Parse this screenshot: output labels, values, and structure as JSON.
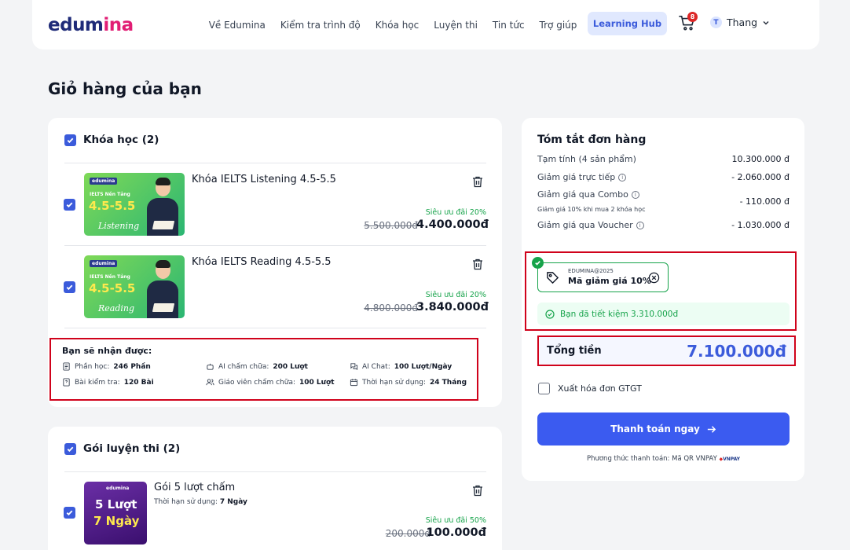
{
  "header": {
    "logo_main": "edum",
    "logo_accent": "ina",
    "nav": [
      "Về Edumina",
      "Kiểm tra trình độ",
      "Khóa học",
      "Luyện thi",
      "Tin tức",
      "Trợ giúp"
    ],
    "hub_label": "Learning Hub",
    "cart_count": "8",
    "user_initial": "T",
    "user_name": "Thang"
  },
  "page_title": "Giỏ hàng của bạn",
  "courses": {
    "section_label": "Khóa học (2)",
    "items": [
      {
        "name": "Khóa IELTS Listening 4.5-5.5",
        "thumb_brand": "edumina",
        "thumb_sub": "IELTS Nền Tảng",
        "thumb_big": "4.5-5.5",
        "thumb_script": "Listening",
        "promo": "Siêu ưu đãi 20%",
        "old_price": "5.500.000đ",
        "new_price": "4.400.000đ"
      },
      {
        "name": "Khóa IELTS Reading 4.5-5.5",
        "thumb_brand": "edumina",
        "thumb_sub": "IELTS Nền Tảng",
        "thumb_big": "4.5-5.5",
        "thumb_script": "Reading",
        "promo": "Siêu ưu đãi 20%",
        "old_price": "4.800.000đ",
        "new_price": "3.840.000đ"
      }
    ],
    "benefits": {
      "title": "Bạn sẽ nhận được:",
      "items": [
        {
          "label": "Phần học:",
          "value": "246 Phần"
        },
        {
          "label": "AI chấm chữa:",
          "value": "200 Lượt"
        },
        {
          "label": "AI Chat:",
          "value": "100 Lượt/Ngày"
        },
        {
          "label": "Bài kiểm tra:",
          "value": "120 Bài"
        },
        {
          "label": "Giáo viên chấm chữa:",
          "value": "100 Lượt"
        },
        {
          "label": "Thời hạn sử dụng:",
          "value": "24 Tháng"
        }
      ]
    }
  },
  "exam_packs": {
    "section_label": "Gói luyện thi (2)",
    "items": [
      {
        "name": "Gói 5 lượt chấm",
        "sub_label": "Thời hạn sử dụng:",
        "sub_value": "7 Ngày",
        "thumb_brand": "edumina",
        "thumb_line1": "5 Lượt",
        "thumb_line2": "7 Ngày",
        "promo": "Siêu ưu đãi 50%",
        "old_price": "200.000đ",
        "new_price": "100.000đ"
      }
    ]
  },
  "summary": {
    "title": "Tóm tắt đơn hàng",
    "rows": [
      {
        "label": "Tạm tính (4 sản phẩm)",
        "value": "10.300.000 đ"
      },
      {
        "label": "Giảm giá trực tiếp",
        "value": "- 2.060.000 đ"
      },
      {
        "label": "Giảm giá qua Combo",
        "value": "- 110.000 đ"
      },
      {
        "label": "Giảm giá qua Voucher",
        "value": "- 1.030.000 đ"
      }
    ],
    "combo_note": "Giảm giá 10% khi mua 2 khóa học",
    "coupon_code": "EDUMINA@2025",
    "coupon_desc": "Mã giảm giá 10%",
    "saved_text": "Bạn đã tiết kiệm 3.310.000đ",
    "total_label": "Tổng tiền",
    "total_value": "7.100.000đ",
    "vat_label": "Xuất hóa đơn GTGT",
    "pay_button": "Thanh toán ngay",
    "pay_method": "Phương thức thanh toán: Mã QR VNPAY",
    "vnpay_logo": "VNPAY"
  },
  "colors": {
    "primary": "#3b5bf0",
    "accent_pink": "#e11d74",
    "success": "#16a34a",
    "highlight_border": "#d0021b"
  }
}
